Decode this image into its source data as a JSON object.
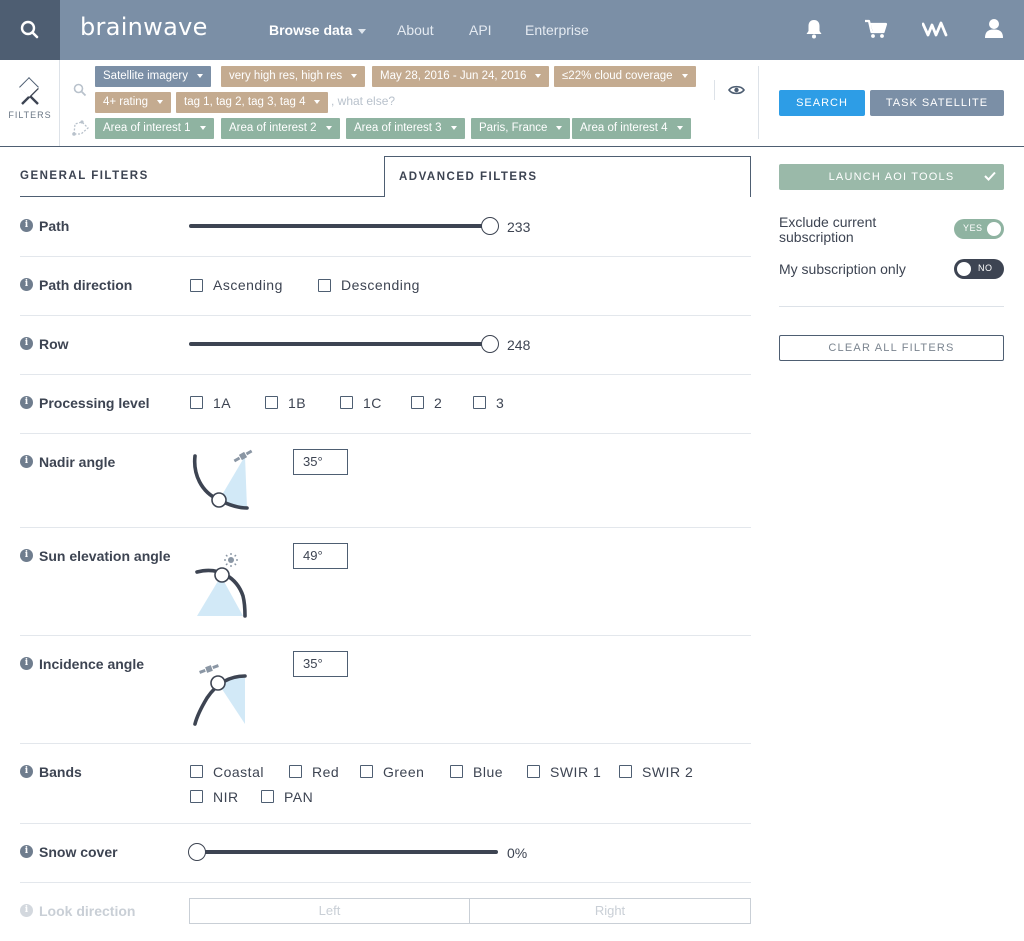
{
  "header": {
    "logo": "brainwave",
    "nav": [
      "Browse data",
      "About",
      "API",
      "Enterprise"
    ],
    "icons": [
      "search-icon",
      "bell-icon",
      "cart-icon",
      "brand-mark-icon",
      "user-icon"
    ]
  },
  "filterbar": {
    "filters_label": "FILTERS",
    "tags_row1": [
      "Satellite imagery",
      "very high res, high res",
      "May 28, 2016 - Jun 24, 2016",
      "≤22% cloud coverage"
    ],
    "tags_row2": [
      "4+ rating",
      "tag 1, tag 2, tag 3, tag 4"
    ],
    "search_placeholder": ", what else?",
    "aoi_tags": [
      "Area of interest 1",
      "Area of interest 2",
      "Area of interest 3",
      "Paris, France",
      "Area of interest 4"
    ],
    "search_label": "SEARCH",
    "task_label": "TASK SATELLITE"
  },
  "tabs": {
    "general": "GENERAL FILTERS",
    "advanced": "ADVANCED FILTERS"
  },
  "filters": {
    "path": {
      "label": "Path",
      "value": "233"
    },
    "path_direction": {
      "label": "Path direction",
      "options": [
        "Ascending",
        "Descending"
      ]
    },
    "row": {
      "label": "Row",
      "value": "248"
    },
    "processing_level": {
      "label": "Processing level",
      "options": [
        "1A",
        "1B",
        "1C",
        "2",
        "3"
      ]
    },
    "nadir_angle": {
      "label": "Nadir angle",
      "value": "35°"
    },
    "sun_elevation": {
      "label": "Sun elevation angle",
      "value": "49°"
    },
    "incidence_angle": {
      "label": "Incidence angle",
      "value": "35°"
    },
    "bands": {
      "label": "Bands",
      "options": [
        "Coastal",
        "Red",
        "Green",
        "Blue",
        "SWIR 1",
        "SWIR 2",
        "NIR",
        "PAN"
      ]
    },
    "snow_cover": {
      "label": "Snow cover",
      "value": "0%"
    },
    "look_direction": {
      "label": "Look direction",
      "options": [
        "Left",
        "Right"
      ]
    }
  },
  "side": {
    "aoi_button": "LAUNCH AOI TOOLS",
    "exclude_label": "Exclude current subscription",
    "exclude_state": "YES",
    "mine_label": "My subscription only",
    "mine_state": "NO",
    "clear_button": "CLEAR ALL FILTERS"
  },
  "colors": {
    "nav_bg": "#7b8fa6",
    "accent_blue": "#2d9de6",
    "tag_gray": "#7b8fa6",
    "tag_tan": "#c4ab90",
    "tag_green": "#8fb3a1",
    "dark": "#3d4452"
  }
}
